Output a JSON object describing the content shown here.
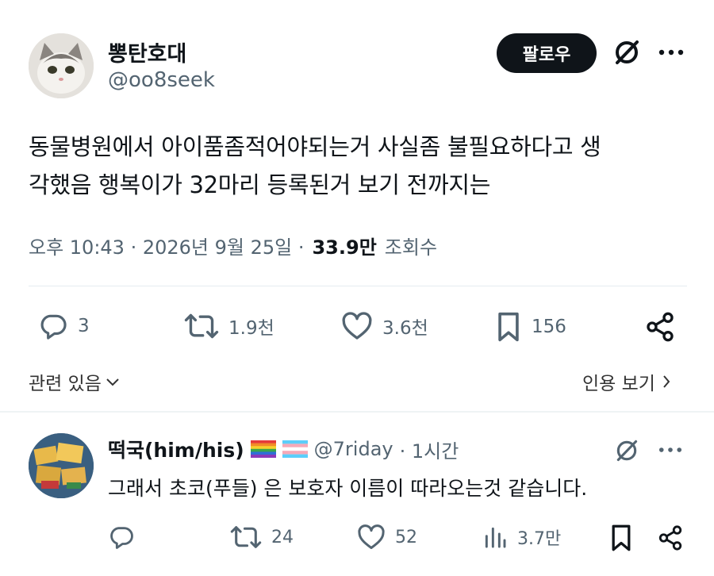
{
  "post": {
    "author_name": "뽕탄호대",
    "author_handle": "@oo8seek",
    "follow_label": "팔로우",
    "text_line1": "동물병원에서 아이품좀적어야되는거 사실좀 불필요하다고 생",
    "text_line2": "각했음 행복이가 32마리 등록된거 보기 전까지는",
    "meta_time": "오후 10:43 · 2026년 9월 25일 ·",
    "meta_views_count": "33.9만",
    "meta_views_label": "조회수",
    "stats": {
      "replies": "3",
      "reposts": "1.9천",
      "likes": "3.6천",
      "bookmarks": "156"
    },
    "related_label": "관련 있음",
    "quotes_label": "인용 보기"
  },
  "reply": {
    "author_name": "떡국(him/his)",
    "author_handle": "@7riday",
    "time": "· 1시간",
    "text": "그래서 초코(푸들) 은 보호자 이름이 따라오는것 같습니다.",
    "stats": {
      "reposts": "24",
      "likes": "52",
      "views": "3.7만"
    }
  },
  "icons": {
    "grok": "grok-icon",
    "more": "more-icon",
    "reply": "reply-icon",
    "repost": "repost-icon",
    "like": "like-icon",
    "bookmark": "bookmark-icon",
    "share": "share-icon",
    "views": "views-icon"
  },
  "colors": {
    "text": "#0f1419",
    "muted": "#536471",
    "button_bg": "#0f1419"
  }
}
